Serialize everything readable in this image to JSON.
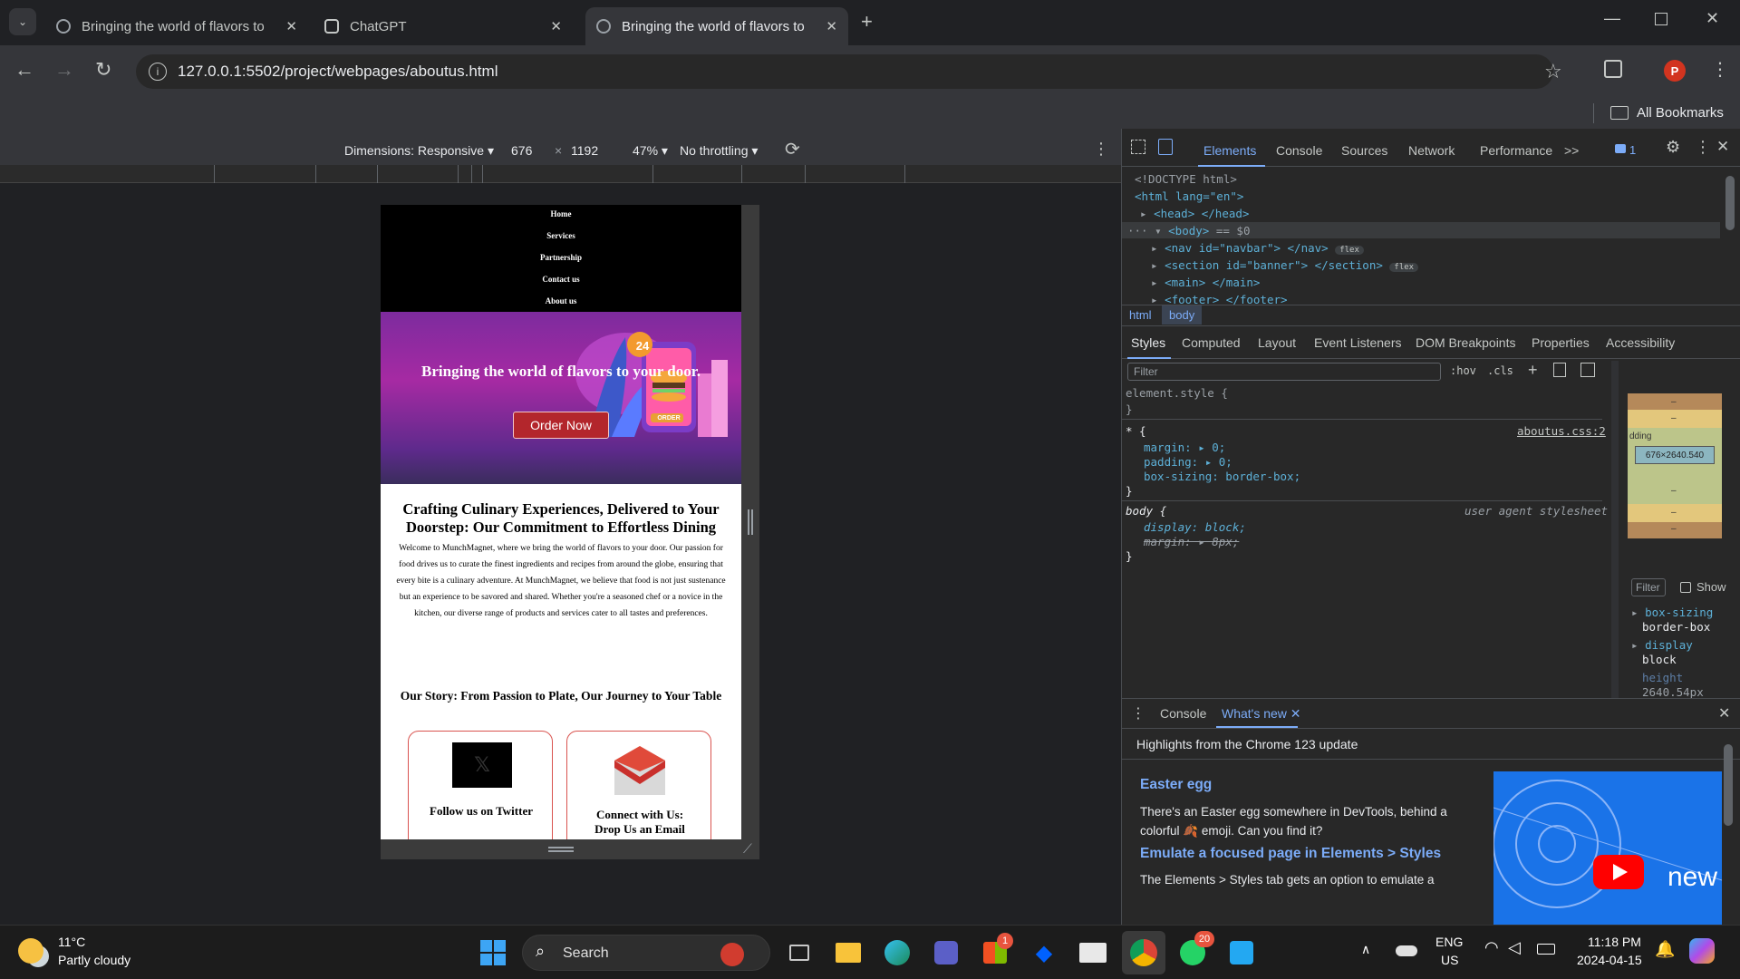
{
  "browser": {
    "tabs": [
      {
        "title": "Bringing the world of flavors to",
        "active": false
      },
      {
        "title": "ChatGPT",
        "active": false
      },
      {
        "title": "Bringing the world of flavors to",
        "active": true
      }
    ],
    "url": "127.0.0.1:5502/project/webpages/aboutus.html",
    "profile_initial": "P",
    "bookmarks_label": "All Bookmarks"
  },
  "device_toolbar": {
    "dimensions_label": "Dimensions: Responsive",
    "width": "676",
    "times": "×",
    "height": "1192",
    "zoom": "47%",
    "throttling": "No throttling"
  },
  "site": {
    "nav": [
      "Home",
      "Services",
      "Partnership",
      "Contact us",
      "About us"
    ],
    "banner_title": "Bringing the world of flavors to your door.",
    "order_button": "Order Now",
    "badge_number": "24",
    "order_tag": "ORDER",
    "about_heading": "Crafting Culinary Experiences, Delivered to Your Doorstep: Our Commitment to Effortless Dining",
    "about_text": "Welcome to MunchMagnet, where we bring the world of flavors to your door. Our passion for food drives us to curate the finest ingredients and recipes from around the globe, ensuring that every bite is a culinary adventure. At MunchMagnet, we believe that food is not just sustenance but an experience to be savored and shared. Whether you're a seasoned chef or a novice in the kitchen, our diverse range of products and services cater to all tastes and preferences.",
    "story_heading": "Our Story: From Passion to Plate, Our Journey to Your Table",
    "card1_title": "Follow us on Twitter",
    "card2_title": "Connect with Us: Drop Us an Email"
  },
  "devtools": {
    "tabs": [
      "Elements",
      "Console",
      "Sources",
      "Network",
      "Performance",
      ">>"
    ],
    "issues_count": "1",
    "dom": {
      "doctype": "<!DOCTYPE html>",
      "html_open": "<html lang=\"en\">",
      "head": "<head> </head>",
      "body_open": "<body>",
      "body_ref": "== $0",
      "nav": "<nav id=\"navbar\"> </nav>",
      "section": "<section id=\"banner\"> </section>",
      "main": "<main> </main>",
      "footer": "<footer> </footer>",
      "flex_badge": "flex"
    },
    "breadcrumbs": [
      "html",
      "body"
    ],
    "style_tabs": [
      "Styles",
      "Computed",
      "Layout",
      "Event Listeners",
      "DOM Breakpoints",
      "Properties",
      "Accessibility"
    ],
    "filter_placeholder": "Filter",
    "hov": ":hov",
    "cls": ".cls",
    "rules": {
      "element_style": "element.style {",
      "close": "}",
      "star_selector": "* {",
      "star_source": "aboutus.css:2",
      "margin": "margin: ▸ 0;",
      "padding": "padding: ▸ 0;",
      "box_sizing": "box-sizing: border-box;",
      "body_selector": "body {",
      "body_source": "user agent stylesheet",
      "display": "display: block;",
      "margin_struck": "margin: ▸ 8px;"
    },
    "box_model": {
      "size": "676×2640.540",
      "dash": "–",
      "padding_label": "dding"
    },
    "computed": {
      "filter": "Filter",
      "show": "Show",
      "items": [
        {
          "prop": "box-sizing",
          "value": "border-box"
        },
        {
          "prop": "display",
          "value": "block"
        },
        {
          "prop": "height",
          "value": "2640.54px"
        }
      ]
    },
    "drawer": {
      "tabs": [
        "Console",
        "What's new"
      ],
      "highlight": "Highlights from the Chrome 123 update",
      "sections": [
        {
          "title": "Easter egg",
          "body": "There's an Easter egg somewhere in DevTools, behind a colorful 🍂 emoji. Can you find it?"
        },
        {
          "title": "Emulate a focused page in Elements > Styles",
          "body": "The Elements > Styles tab gets an option to emulate a"
        }
      ],
      "video_text": "new"
    }
  },
  "taskbar": {
    "weather_temp": "11°C",
    "weather_desc": "Partly cloudy",
    "search_label": "Search",
    "teams_badge": "1",
    "whatsapp_badge": "20",
    "lang1": "ENG",
    "lang2": "US",
    "time": "11:18 PM",
    "date": "2024-04-15"
  }
}
